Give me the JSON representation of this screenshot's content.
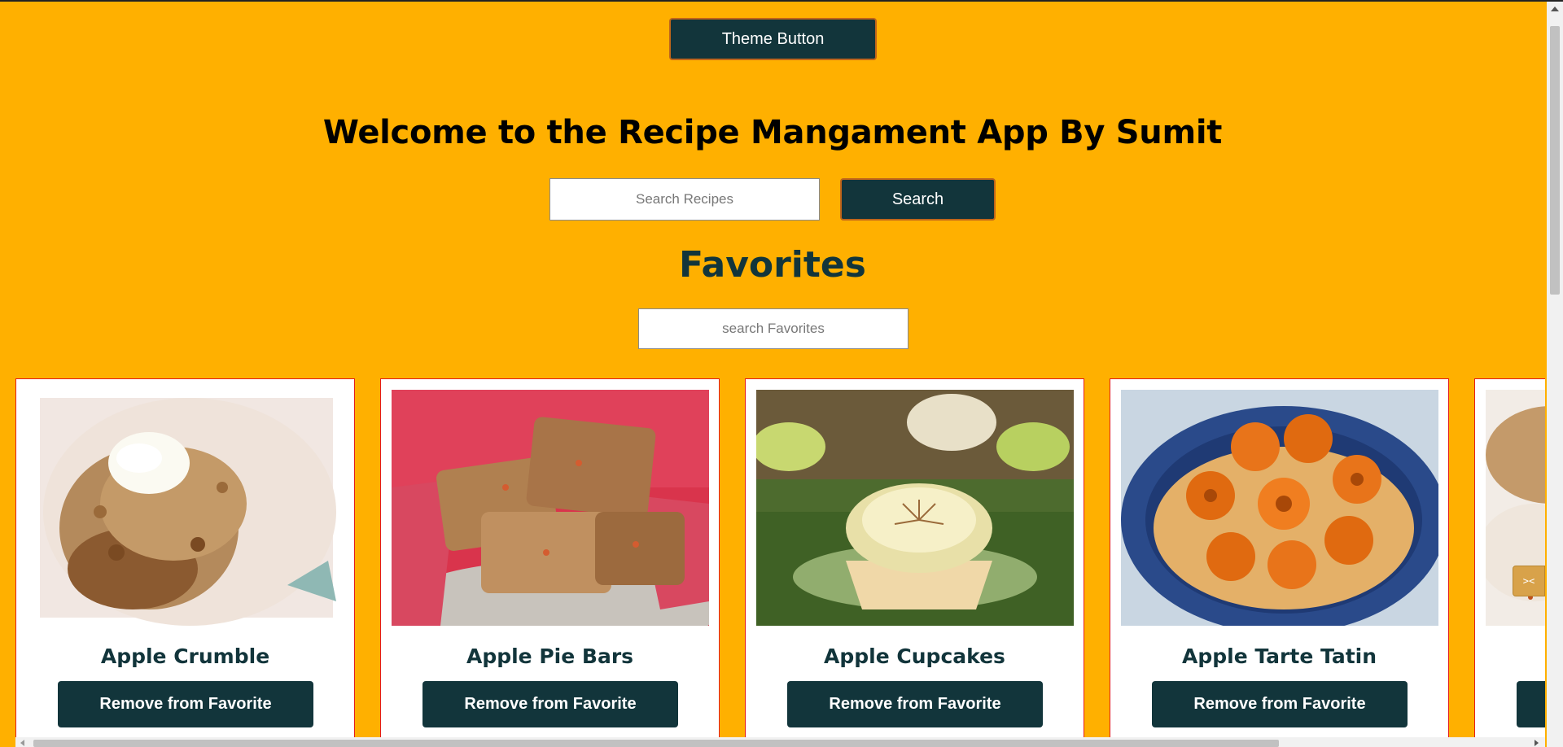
{
  "theme_button": {
    "label": "Theme Button"
  },
  "header": {
    "title": "Welcome to the Recipe Mangament App By Sumit"
  },
  "search": {
    "placeholder": "Search Recipes",
    "button_label": "Search"
  },
  "favorites": {
    "title": "Favorites",
    "search_placeholder": "search Favorites",
    "items": [
      {
        "name": "Apple Crumble",
        "button_label": "Remove from Favorite"
      },
      {
        "name": "Apple Pie Bars",
        "button_label": "Remove from Favorite"
      },
      {
        "name": "Apple Cupcakes",
        "button_label": "Remove from Favorite"
      },
      {
        "name": "Apple Tarte Tatin",
        "button_label": "Remove from Favorite"
      },
      {
        "name": "",
        "button_label": ""
      }
    ]
  },
  "colors": {
    "background": "#FFB000",
    "primary_button": "#12353B",
    "card_border": "#E31B1B",
    "heading_accent": "#12353B"
  },
  "icons": {
    "side_widget": "collapse-icon"
  }
}
